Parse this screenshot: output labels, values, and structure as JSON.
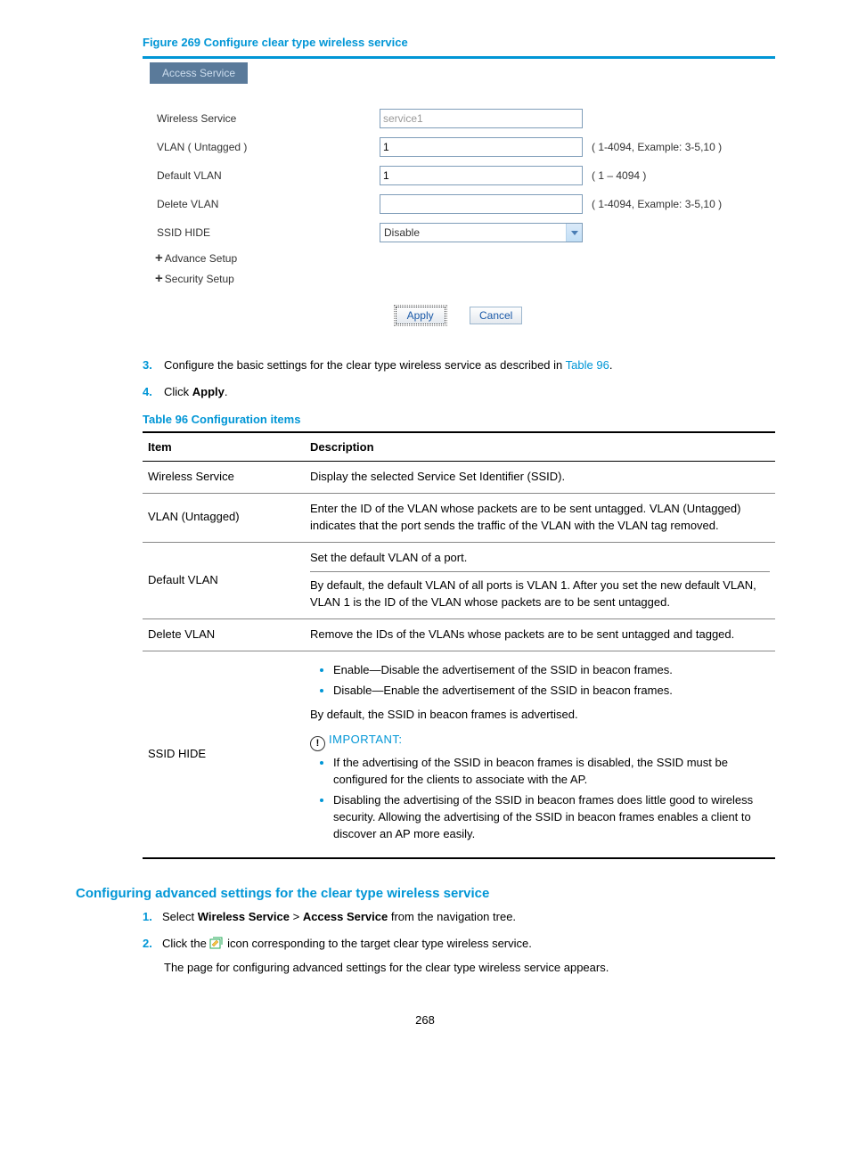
{
  "figure_caption": "Figure 269 Configure clear type wireless service",
  "screenshot": {
    "tab": "Access Service",
    "rows": {
      "wireless_service": {
        "label": "Wireless Service",
        "value": "service1"
      },
      "vlan_untagged": {
        "label": "VLAN ( Untagged )",
        "value": "1",
        "hint": "( 1-4094, Example: 3-5,10 )"
      },
      "default_vlan": {
        "label": "Default VLAN",
        "value": "1",
        "hint": "( 1 – 4094 )"
      },
      "delete_vlan": {
        "label": "Delete VLAN",
        "value": "",
        "hint": "( 1-4094, Example: 3-5,10 )"
      },
      "ssid_hide": {
        "label": "SSID HIDE",
        "value": "Disable"
      }
    },
    "advance_setup": "Advance Setup",
    "security_setup": "Security Setup",
    "apply": "Apply",
    "cancel": "Cancel"
  },
  "steps_a": {
    "s3_pre": "Configure the basic settings for the clear type wireless service as described in ",
    "s3_link": "Table 96",
    "s3_post": ".",
    "s4_pre": "Click ",
    "s4_bold": "Apply",
    "s4_post": "."
  },
  "table_caption": "Table 96 Configuration items",
  "table": {
    "h1": "Item",
    "h2": "Description",
    "r1_item": "Wireless Service",
    "r1_desc": "Display the selected Service Set Identifier (SSID).",
    "r2_item": "VLAN (Untagged)",
    "r2_desc": "Enter the ID of the VLAN whose packets are to be sent untagged. VLAN (Untagged) indicates that the port sends the traffic of the VLAN with the VLAN tag removed.",
    "r3_item": "Default VLAN",
    "r3_desc_a": "Set the default VLAN of a port.",
    "r3_desc_b": "By default, the default VLAN of all ports is VLAN 1. After you set the new default VLAN, VLAN 1 is the ID of the VLAN whose packets are to be sent untagged.",
    "r4_item": "Delete VLAN",
    "r4_desc": "Remove the IDs of the VLANs whose packets are to be sent untagged and tagged.",
    "r5_item": "SSID HIDE",
    "r5_b1": "Enable—Disable the advertisement of the SSID in beacon frames.",
    "r5_b2": "Disable—Enable the advertisement of the SSID in beacon frames.",
    "r5_p1": "By default, the SSID in beacon frames is advertised.",
    "r5_important": "IMPORTANT:",
    "r5_b3": "If the advertising of the SSID in beacon frames is disabled, the SSID must be configured for the clients to associate with the AP.",
    "r5_b4": "Disabling the advertising of the SSID in beacon frames does little good to wireless security. Allowing the advertising of the SSID in beacon frames enables a client to discover an AP more easily."
  },
  "section_heading": "Configuring advanced settings for the clear type wireless service",
  "steps_b": {
    "s1_a": "Select ",
    "s1_b": "Wireless Service",
    "s1_c": " > ",
    "s1_d": "Access Service",
    "s1_e": " from the navigation tree.",
    "s2_a": "Click the ",
    "s2_b": " icon corresponding to the target clear type wireless service.",
    "s2_cont": "The page for configuring advanced settings for the clear type wireless service appears."
  },
  "pagenum": "268"
}
